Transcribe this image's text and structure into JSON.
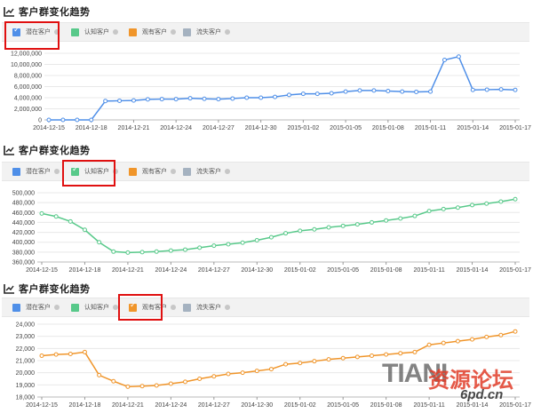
{
  "panels": [
    {
      "title": "客户群变化趋势",
      "legend": [
        {
          "label": "潜在客户",
          "color": "#4f8fe8",
          "checked": true
        },
        {
          "label": "认知客户",
          "color": "#58c98a",
          "checked": false
        },
        {
          "label": "观有客户",
          "color": "#f0952a",
          "checked": false
        },
        {
          "label": "流失客户",
          "color": "#a5b2c0",
          "checked": false
        }
      ],
      "highlighted_legend": 0
    },
    {
      "title": "客户群变化趋势",
      "legend": [
        {
          "label": "潜在客户",
          "color": "#4f8fe8",
          "checked": false
        },
        {
          "label": "认知客户",
          "color": "#58c98a",
          "checked": true
        },
        {
          "label": "观有客户",
          "color": "#f0952a",
          "checked": false
        },
        {
          "label": "流失客户",
          "color": "#a5b2c0",
          "checked": false
        }
      ],
      "highlighted_legend": 1
    },
    {
      "title": "客户群变化趋势",
      "legend": [
        {
          "label": "潜在客户",
          "color": "#4f8fe8",
          "checked": false
        },
        {
          "label": "认知客户",
          "color": "#58c98a",
          "checked": false
        },
        {
          "label": "观有客户",
          "color": "#f0952a",
          "checked": true
        },
        {
          "label": "流失客户",
          "color": "#a5b2c0",
          "checked": false
        }
      ],
      "highlighted_legend": 2
    }
  ],
  "watermark": {
    "brand": "TIANI",
    "cn": "资源论坛",
    "site": "6pd.cn"
  },
  "chart_data": [
    {
      "type": "line",
      "title": "客户群变化趋势",
      "x": [
        "2014-12-15",
        "2014-12-16",
        "2014-12-17",
        "2014-12-18",
        "2014-12-19",
        "2014-12-20",
        "2014-12-21",
        "2014-12-22",
        "2014-12-23",
        "2014-12-24",
        "2014-12-25",
        "2014-12-26",
        "2014-12-27",
        "2014-12-28",
        "2014-12-29",
        "2014-12-30",
        "2014-12-31",
        "2015-01-01",
        "2015-01-02",
        "2015-01-03",
        "2015-01-04",
        "2015-01-05",
        "2015-01-06",
        "2015-01-07",
        "2015-01-08",
        "2015-01-09",
        "2015-01-10",
        "2015-01-11",
        "2015-01-12",
        "2015-01-13",
        "2015-01-14",
        "2015-01-15",
        "2015-01-16",
        "2015-01-17"
      ],
      "x_ticks": [
        "2014-12-15",
        "2014-12-18",
        "2014-12-21",
        "2014-12-24",
        "2014-12-27",
        "2014-12-30",
        "2015-01-02",
        "2015-01-05",
        "2015-01-08",
        "2015-01-11",
        "2015-01-14",
        "2015-01-17"
      ],
      "series": [
        {
          "name": "潜在客户",
          "color": "#4f8fe8",
          "values": [
            0,
            0,
            0,
            0,
            3400000,
            3450000,
            3500000,
            3700000,
            3750000,
            3750000,
            3900000,
            3800000,
            3750000,
            3850000,
            4000000,
            4000000,
            4150000,
            4500000,
            4700000,
            4700000,
            4800000,
            5100000,
            5300000,
            5300000,
            5200000,
            5100000,
            5050000,
            5100000,
            10800000,
            11400000,
            5400000,
            5450000,
            5500000,
            5400000
          ]
        }
      ],
      "y_ticks": [
        "0",
        "2,000,000",
        "4,000,000",
        "6,000,000",
        "8,000,000",
        "10,000,000",
        "12,000,000"
      ],
      "ylim": [
        0,
        12000000
      ],
      "grid": true
    },
    {
      "type": "line",
      "title": "客户群变化趋势",
      "x": [
        "2014-12-15",
        "2014-12-16",
        "2014-12-17",
        "2014-12-18",
        "2014-12-19",
        "2014-12-20",
        "2014-12-21",
        "2014-12-22",
        "2014-12-23",
        "2014-12-24",
        "2014-12-25",
        "2014-12-26",
        "2014-12-27",
        "2014-12-28",
        "2014-12-29",
        "2014-12-30",
        "2014-12-31",
        "2015-01-01",
        "2015-01-02",
        "2015-01-03",
        "2015-01-04",
        "2015-01-05",
        "2015-01-06",
        "2015-01-07",
        "2015-01-08",
        "2015-01-09",
        "2015-01-10",
        "2015-01-11",
        "2015-01-12",
        "2015-01-13",
        "2015-01-14",
        "2015-01-15",
        "2015-01-16",
        "2015-01-17"
      ],
      "x_ticks": [
        "2014-12-15",
        "2014-12-18",
        "2014-12-21",
        "2014-12-24",
        "2014-12-27",
        "2014-12-30",
        "2015-01-02",
        "2015-01-05",
        "2015-01-08",
        "2015-01-11",
        "2015-01-14",
        "2015-01-17"
      ],
      "series": [
        {
          "name": "认知客户",
          "color": "#58c98a",
          "values": [
            458000,
            452000,
            442000,
            425000,
            400000,
            381000,
            379000,
            380000,
            381000,
            383000,
            385000,
            389000,
            393000,
            396000,
            399000,
            404000,
            410000,
            418000,
            423000,
            426000,
            430000,
            433000,
            436000,
            440000,
            444000,
            448000,
            453000,
            463000,
            467000,
            470000,
            475000,
            478000,
            482000,
            487000
          ]
        }
      ],
      "y_ticks": [
        "360,000",
        "380,000",
        "400,000",
        "420,000",
        "440,000",
        "460,000",
        "480,000",
        "500,000"
      ],
      "ylim": [
        360000,
        500000
      ],
      "grid": true
    },
    {
      "type": "line",
      "title": "客户群变化趋势",
      "x": [
        "2014-12-15",
        "2014-12-16",
        "2014-12-17",
        "2014-12-18",
        "2014-12-19",
        "2014-12-20",
        "2014-12-21",
        "2014-12-22",
        "2014-12-23",
        "2014-12-24",
        "2014-12-25",
        "2014-12-26",
        "2014-12-27",
        "2014-12-28",
        "2014-12-29",
        "2014-12-30",
        "2014-12-31",
        "2015-01-01",
        "2015-01-02",
        "2015-01-03",
        "2015-01-04",
        "2015-01-05",
        "2015-01-06",
        "2015-01-07",
        "2015-01-08",
        "2015-01-09",
        "2015-01-10",
        "2015-01-11",
        "2015-01-12",
        "2015-01-13",
        "2015-01-14",
        "2015-01-15",
        "2015-01-16",
        "2015-01-17"
      ],
      "x_ticks": [
        "2014-12-15",
        "2014-12-18",
        "2014-12-21",
        "2014-12-24",
        "2014-12-27",
        "2014-12-30",
        "2015-01-02",
        "2015-01-05",
        "2015-01-08",
        "2015-01-11",
        "2015-01-14",
        "2015-01-17"
      ],
      "series": [
        {
          "name": "观有客户",
          "color": "#f0952a",
          "values": [
            21400,
            21500,
            21550,
            21700,
            19800,
            19300,
            18850,
            18900,
            18950,
            19100,
            19250,
            19500,
            19700,
            19900,
            20000,
            20150,
            20300,
            20700,
            20800,
            20950,
            21100,
            21200,
            21300,
            21400,
            21500,
            21600,
            21700,
            22300,
            22450,
            22600,
            22750,
            22950,
            23100,
            23400
          ]
        }
      ],
      "y_ticks": [
        "18,000",
        "19,000",
        "20,000",
        "21,000",
        "22,000",
        "23,000",
        "24,000"
      ],
      "ylim": [
        18000,
        24000
      ],
      "grid": true
    }
  ]
}
